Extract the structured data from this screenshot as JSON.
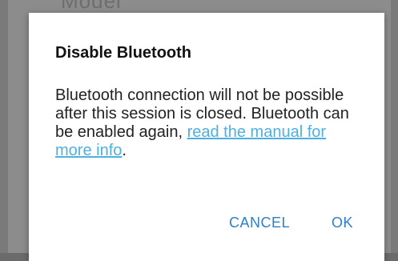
{
  "backdrop": {
    "partial_text": "Model"
  },
  "dialog": {
    "title": "Disable Bluetooth",
    "message_before_link": "Bluetooth connection will not be possible after this session is closed. Bluetooth can be enabled again, ",
    "link_text": "read the manual for more info",
    "message_after_link": ".",
    "cancel_label": "CANCEL",
    "ok_label": "OK"
  },
  "colors": {
    "link": "#4fb0e0",
    "button": "#2e7fc9",
    "scrim": "#7a7a7a"
  }
}
